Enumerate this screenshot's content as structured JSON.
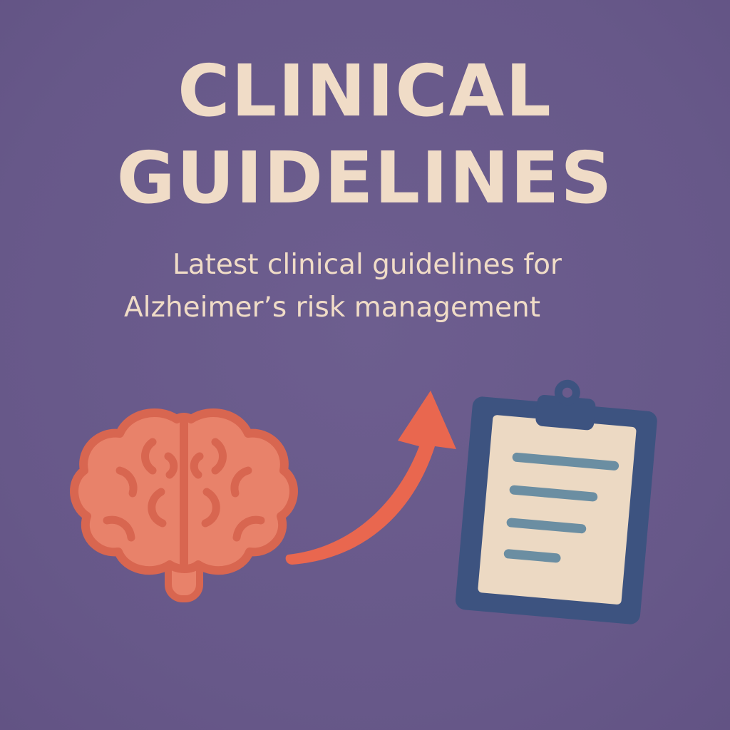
{
  "poster": {
    "title_lines": [
      "CLINICAL",
      "GUIDELINES"
    ],
    "subtitle_lines": [
      "Latest clinical guidelines for",
      "Alzheimer’s risk management"
    ]
  },
  "icons": {
    "brain": "brain-icon",
    "arrow": "arrow-up-right-icon",
    "clipboard": "clipboard-icon"
  },
  "colors": {
    "background": "#6a5b8c",
    "text": "#f0dcc7",
    "brain_fill": "#e8826a",
    "brain_stroke": "#d86650",
    "arrow": "#e9674f",
    "clipboard_board": "#3d5380",
    "clipboard_paper": "#ecd9c3",
    "clipboard_lines": "#6b8ea2"
  }
}
